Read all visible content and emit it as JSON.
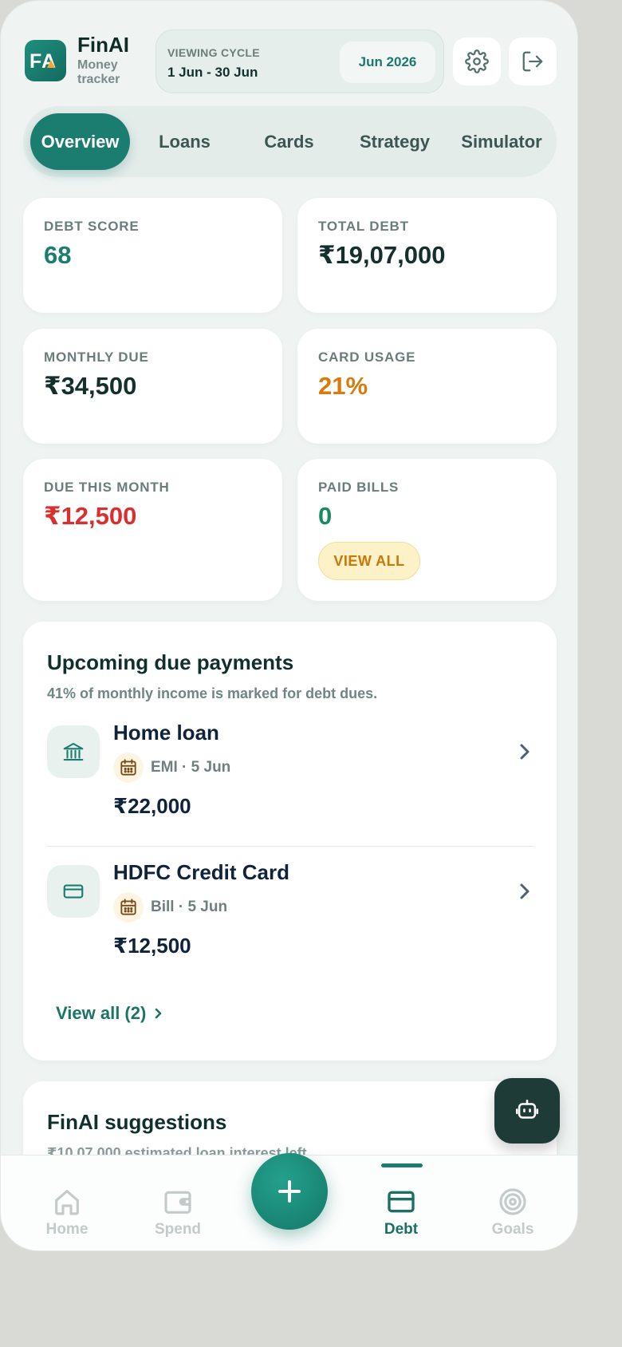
{
  "header": {
    "logo_text": "FA",
    "app_name": "FinAI",
    "app_subtitle": "Money tracker",
    "cycle_label": "VIEWING CYCLE",
    "cycle_range": "1 Jun - 30 Jun",
    "cycle_month": "Jun 2026"
  },
  "tabs": [
    {
      "label": "Overview",
      "active": true
    },
    {
      "label": "Loans",
      "active": false
    },
    {
      "label": "Cards",
      "active": false
    },
    {
      "label": "Strategy",
      "active": false
    },
    {
      "label": "Simulator",
      "active": false
    }
  ],
  "stats": {
    "debt_score": {
      "label": "DEBT SCORE",
      "value": "68",
      "color": "#1b7d6f"
    },
    "total_debt": {
      "label": "TOTAL DEBT",
      "value": "₹19,07,000",
      "color": "#14302c"
    },
    "monthly_due": {
      "label": "MONTHLY DUE",
      "value": "₹34,500",
      "color": "#14302c"
    },
    "card_usage": {
      "label": "CARD USAGE",
      "value": "21%",
      "color": "#d97a0a"
    },
    "due_this_month": {
      "label": "DUE THIS MONTH",
      "value": "₹12,500",
      "color": "#d92f2f"
    },
    "paid_bills": {
      "label": "PAID BILLS",
      "value": "0",
      "color": "#1b8a5e",
      "view_all": "VIEW ALL"
    }
  },
  "upcoming": {
    "title": "Upcoming due payments",
    "subtitle": "41% of monthly income is marked for debt dues.",
    "items": [
      {
        "title": "Home loan",
        "meta": "EMI · 5 Jun",
        "amount": "₹22,000",
        "icon": "bank-icon"
      },
      {
        "title": "HDFC Credit Card",
        "meta": "Bill · 5 Jun",
        "amount": "₹12,500",
        "icon": "credit-card-icon"
      }
    ],
    "view_all": "View all (2)"
  },
  "suggestions": {
    "title": "FinAI suggestions",
    "peek_text": "₹10,07,000 estimated loan interest left"
  },
  "bottom_nav": [
    {
      "label": "Home",
      "icon": "home-icon",
      "active": false
    },
    {
      "label": "Spend",
      "icon": "wallet-icon",
      "active": false
    },
    {
      "label": "Debt",
      "icon": "credit-card-icon",
      "active": true
    },
    {
      "label": "Goals",
      "icon": "target-icon",
      "active": false
    }
  ],
  "colors": {
    "accent": "#1b7d6f",
    "background": "#eff4f3",
    "warning": "#d97a0a",
    "danger": "#d92f2f"
  }
}
